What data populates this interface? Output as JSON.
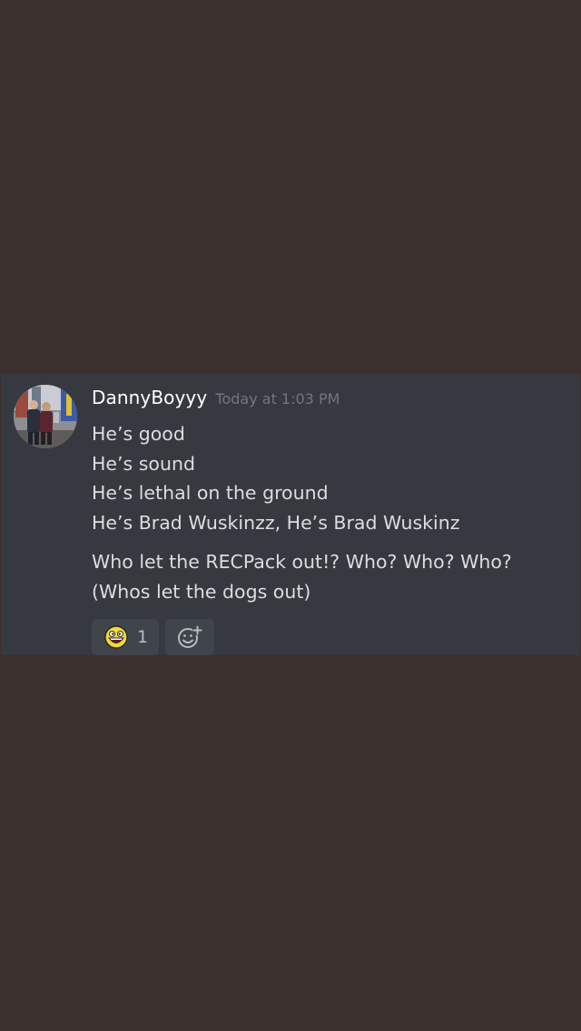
{
  "message": {
    "author": "DannyBoyyy",
    "timestamp": "Today at 1:03 PM",
    "lines": [
      "He’s good",
      "He’s sound",
      "He’s lethal on the ground",
      "He’s Brad Wuskinzz, He’s Brad Wuskinz"
    ],
    "lines2": [
      "Who let the RECPack out!? Who? Who? Who?",
      "(Whos let the dogs out)"
    ]
  },
  "reactions": [
    {
      "icon": "awesome-face-emoji-icon",
      "count": "1"
    }
  ],
  "add_reaction_icon": "add-reaction-icon",
  "colors": {
    "page_background": "#3b302e",
    "card_background": "#36393f",
    "username": "#ffffff",
    "timestamp": "#72767d",
    "text": "#dcddde",
    "reaction_background": "#40444b"
  }
}
